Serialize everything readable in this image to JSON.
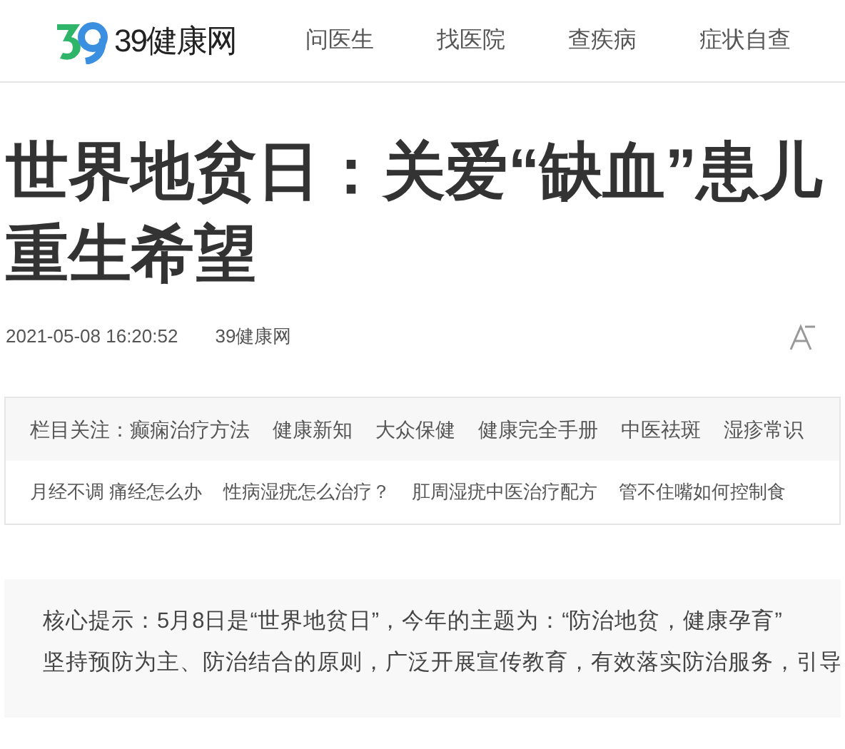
{
  "header": {
    "logo_text": "39健康网",
    "nav": [
      "问医生",
      "找医院",
      "查疾病",
      "症状自查"
    ]
  },
  "article": {
    "title_lines": [
      "世界地贫日：关爱“缺血”患儿",
      "重生希望"
    ],
    "date": "2021-05-08 16:20:52",
    "source": "39健康网"
  },
  "topics": {
    "label": "栏目关注：",
    "row_1": [
      "癫痫治疗方法",
      "健康新知",
      "大众保健",
      "健康完全手册",
      "中医祛斑",
      "湿疹常识"
    ],
    "row_2": [
      "月经不调 痛经怎么办",
      "性病湿疣怎么治疗？",
      "肛周湿疣中医治疗配方",
      "管不住嘴如何控制食"
    ]
  },
  "summary": {
    "lines": [
      "核心提示：5月8日是“世界地贫日”，今年的主题为：“防治地贫，健康孕育”",
      "坚持预防为主、防治结合的原则，广泛开展宣传教育，有效落实防治服务，引导"
    ]
  }
}
